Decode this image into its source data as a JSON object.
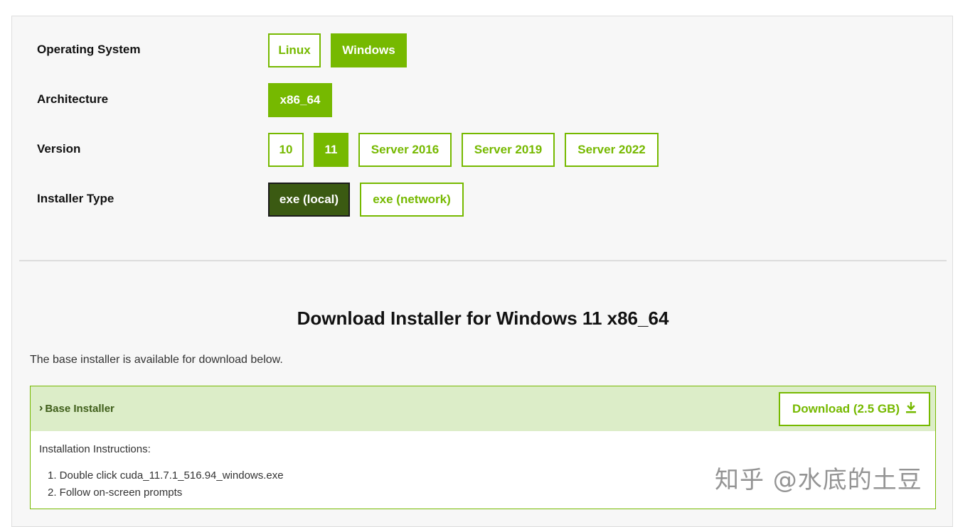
{
  "selectors": {
    "os": {
      "label": "Operating System",
      "options": [
        "Linux",
        "Windows"
      ],
      "selected": "Windows"
    },
    "architecture": {
      "label": "Architecture",
      "options": [
        "x86_64"
      ],
      "selected": "x86_64"
    },
    "version": {
      "label": "Version",
      "options": [
        "10",
        "11",
        "Server 2016",
        "Server 2019",
        "Server 2022"
      ],
      "selected": "11"
    },
    "installer_type": {
      "label": "Installer Type",
      "options": [
        "exe (local)",
        "exe (network)"
      ],
      "selected": "exe (local)"
    }
  },
  "download": {
    "title": "Download Installer for Windows 11 x86_64",
    "description": "The base installer is available for download below.",
    "base_installer": {
      "label": "Base Installer",
      "button_label": "Download (2.5 GB)",
      "instructions_title": "Installation Instructions:",
      "steps": [
        "1. Double click cuda_11.7.1_516.94_windows.exe",
        "2. Follow on-screen prompts"
      ]
    }
  },
  "watermark": "知乎 @水底的土豆",
  "colors": {
    "accent": "#76b900",
    "selected_dark": "#3b5a12",
    "header_bg": "#dcedc8"
  }
}
